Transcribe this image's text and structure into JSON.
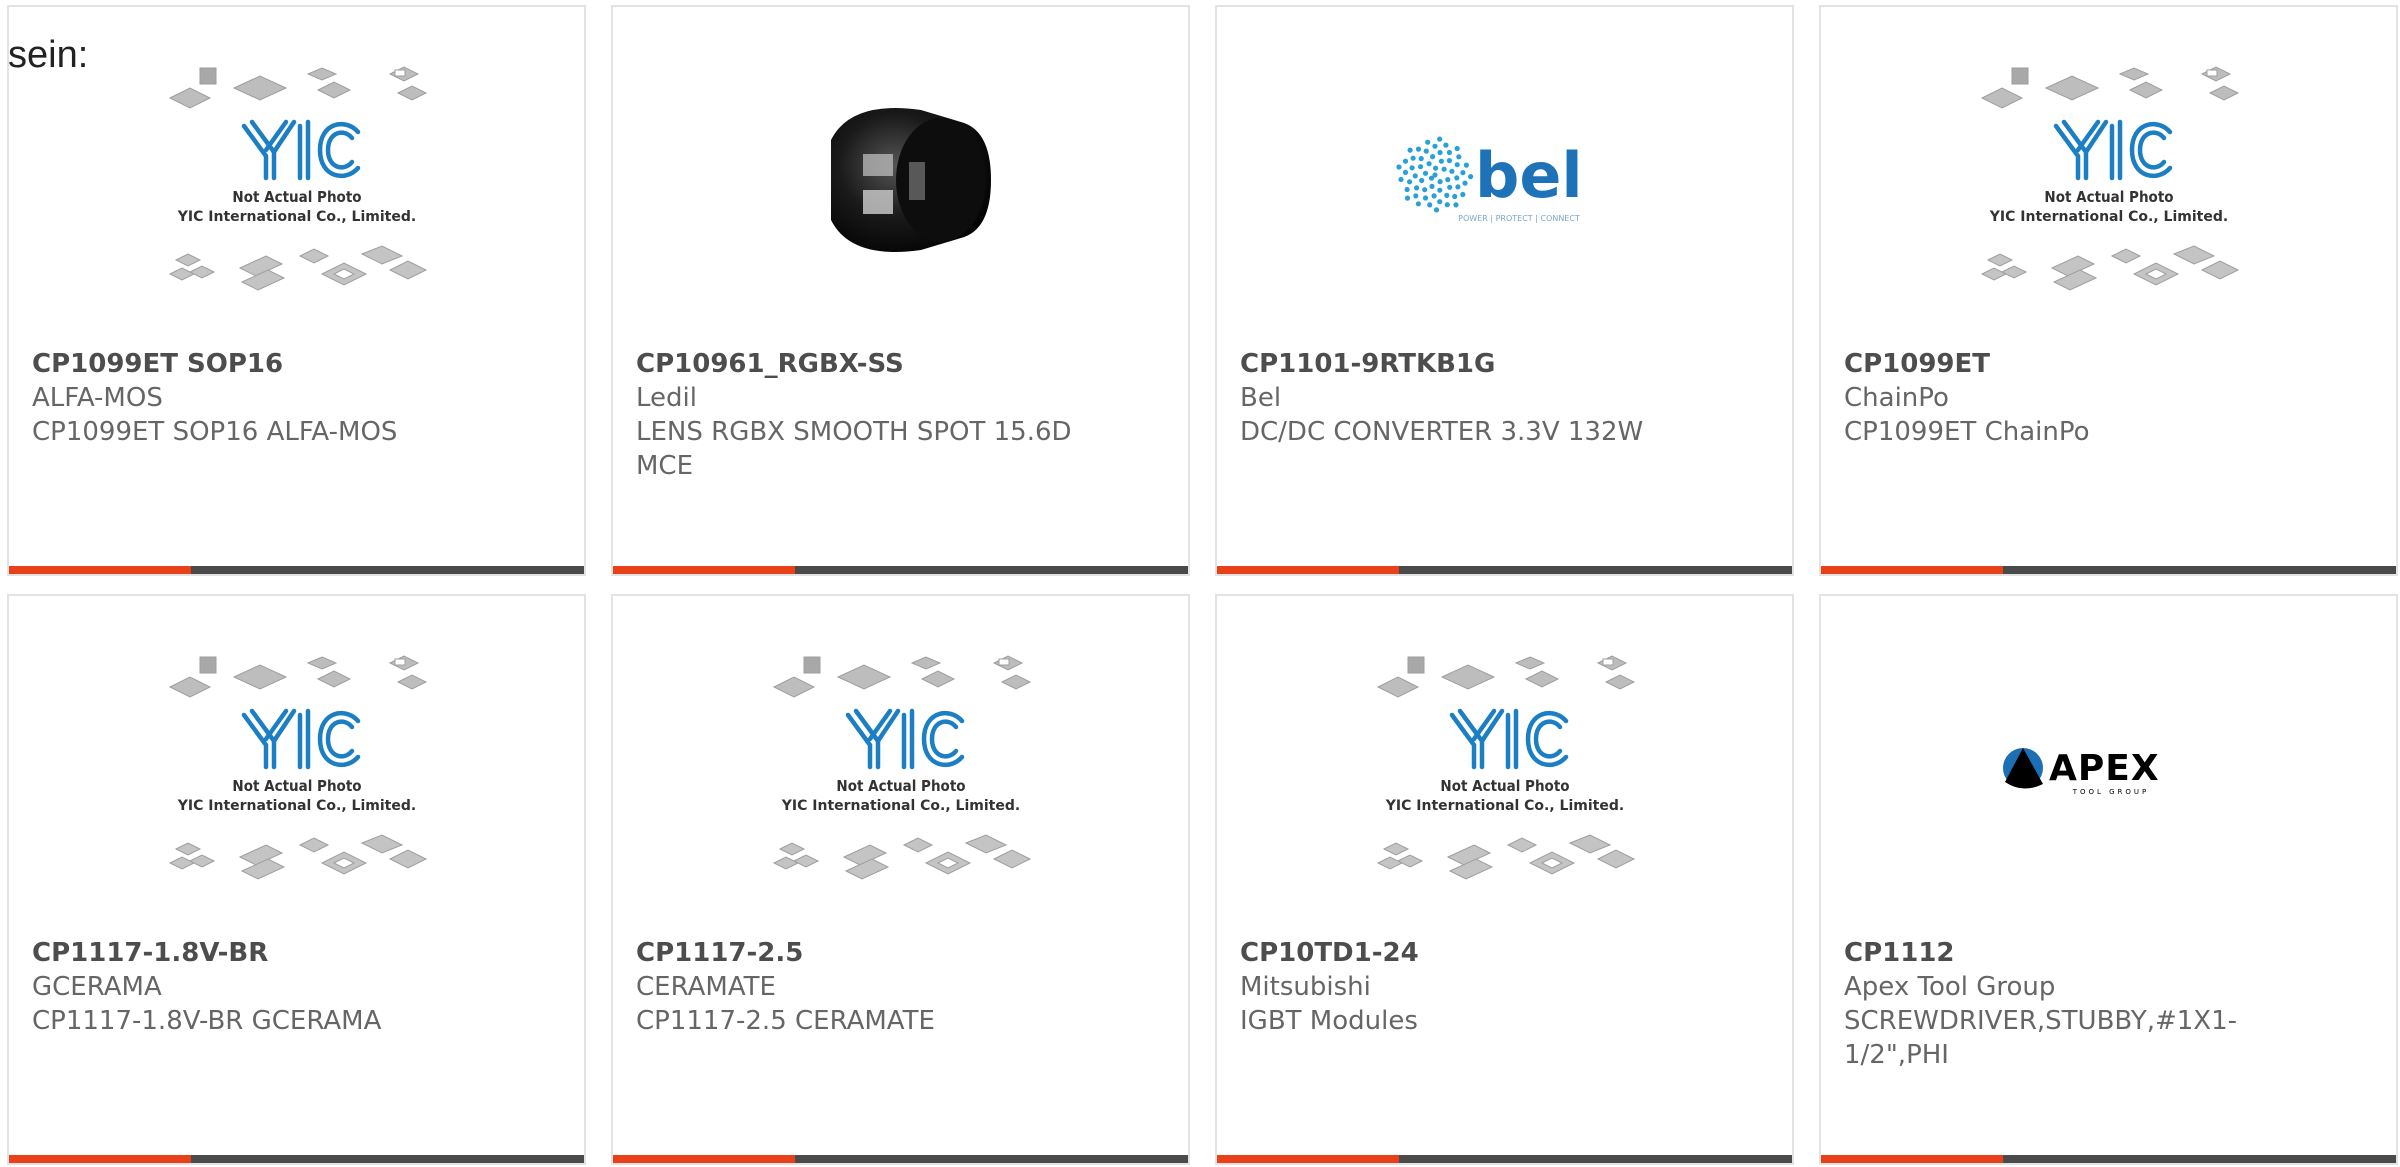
{
  "intro": "sein:",
  "placeholder_image": {
    "line1": "Not Actual Photo",
    "line2": "YIC International Co., Limited."
  },
  "logos": {
    "bel_tagline": "POWER | PROTECT | CONNECT"
  },
  "colors": {
    "accent": "#e8411a",
    "bar_base": "#4a4a4a",
    "text": "#666666",
    "bel_blue": "#1e73b8"
  },
  "products": [
    {
      "part_number": "CP1099ET SOP16",
      "brand": "ALFA-MOS",
      "description": "CP1099ET SOP16 ALFA-MOS",
      "image": "placeholder"
    },
    {
      "part_number": "CP10961_RGBX-SS",
      "brand": "Ledil",
      "description": "LENS RGBX SMOOTH SPOT 15.6D MCE",
      "image": "lens"
    },
    {
      "part_number": "CP1101-9RTKB1G",
      "brand": "Bel",
      "description": "DC/DC CONVERTER 3.3V 132W",
      "image": "bel-logo"
    },
    {
      "part_number": "CP1099ET",
      "brand": "ChainPo",
      "description": "CP1099ET ChainPo",
      "image": "placeholder"
    },
    {
      "part_number": "CP1117-1.8V-BR",
      "brand": "GCERAMA",
      "description": "CP1117-1.8V-BR GCERAMA",
      "image": "placeholder"
    },
    {
      "part_number": "CP1117-2.5",
      "brand": "CERAMATE",
      "description": "CP1117-2.5 CERAMATE",
      "image": "placeholder"
    },
    {
      "part_number": "CP10TD1-24",
      "brand": "Mitsubishi",
      "description": "IGBT Modules",
      "image": "placeholder"
    },
    {
      "part_number": "CP1112",
      "brand": "Apex Tool Group",
      "description": "SCREWDRIVER,STUBBY,#1X1-1/2\",PHI",
      "image": "apex-logo"
    }
  ]
}
